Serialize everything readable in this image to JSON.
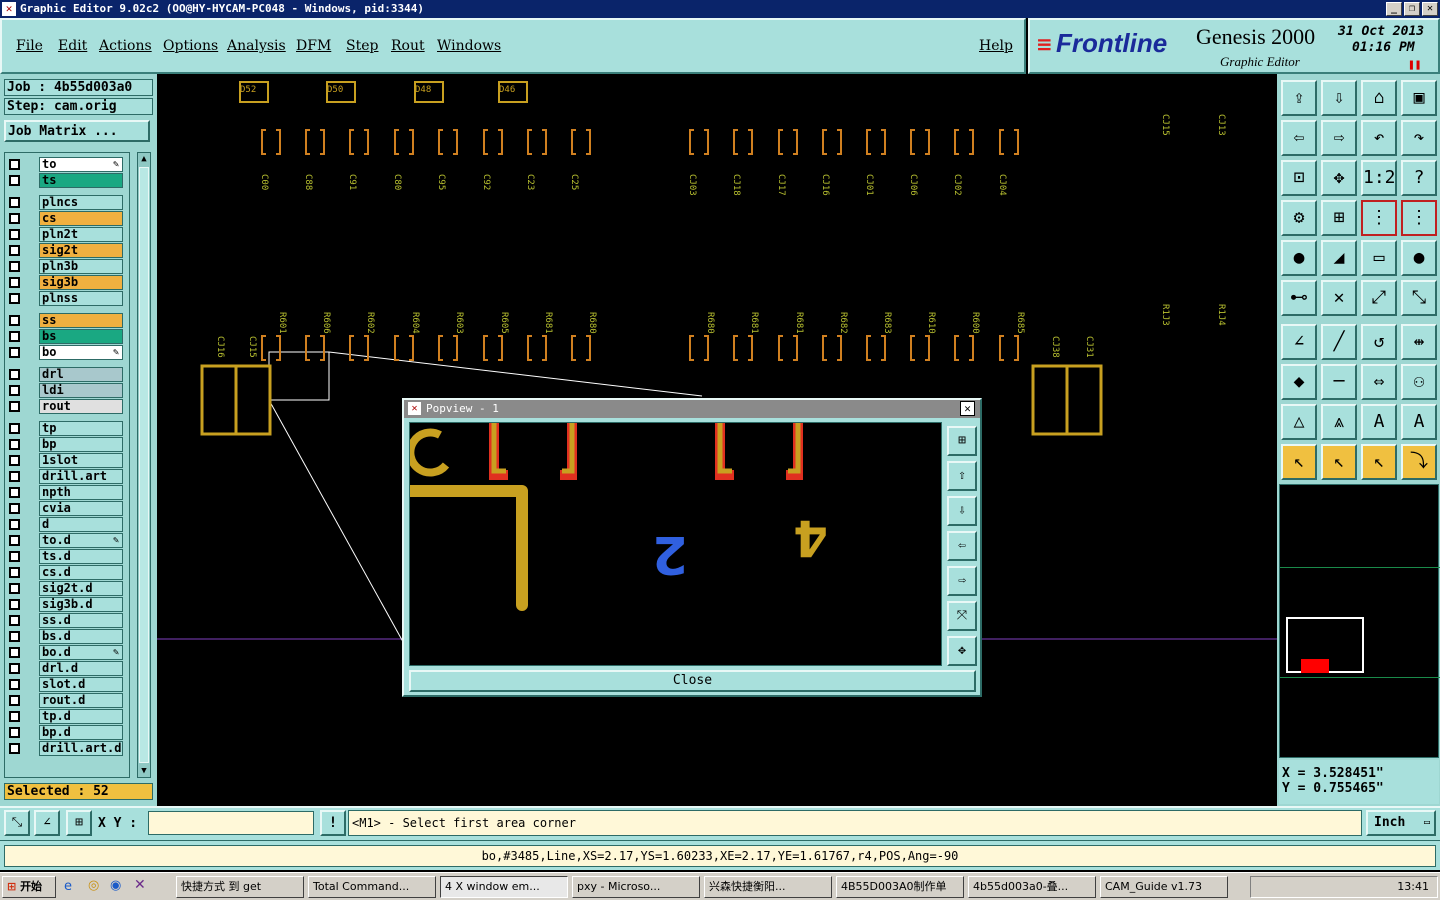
{
  "window": {
    "title": "Graphic Editor 9.02c2 (OO@HY-HYCAM-PC048 - Windows, pid:3344)"
  },
  "menu": [
    "File",
    "Edit",
    "Actions",
    "Options",
    "Analysis",
    "DFM",
    "Step",
    "Rout",
    "Windows"
  ],
  "help_label": "Help",
  "brand": {
    "logo": "Frontline",
    "product": "Genesis 2000",
    "subtitle": "Graphic Editor",
    "date": "31 Oct 2013",
    "time": "01:16 PM"
  },
  "job": {
    "job_label": "Job : 4b55d003a0",
    "step_label": "Step: cam.orig",
    "matrix_button": "Job Matrix ..."
  },
  "layers": [
    {
      "name": "to",
      "color": "#ffffff",
      "edit": true
    },
    {
      "name": "ts",
      "color": "#1aa882",
      "edit": false
    },
    {
      "name": "plncs",
      "color": "#a8e0dc",
      "edit": false
    },
    {
      "name": "cs",
      "color": "#f0b040",
      "edit": false
    },
    {
      "name": "pln2t",
      "color": "#a8e0dc",
      "edit": false
    },
    {
      "name": "sig2t",
      "color": "#f0b040",
      "edit": false
    },
    {
      "name": "pln3b",
      "color": "#a8e0dc",
      "edit": false
    },
    {
      "name": "sig3b",
      "color": "#f0b040",
      "edit": false
    },
    {
      "name": "plnss",
      "color": "#a8e0dc",
      "edit": false
    },
    {
      "name": "ss",
      "color": "#f0b040",
      "edit": false
    },
    {
      "name": "bs",
      "color": "#1aa882",
      "edit": false
    },
    {
      "name": "bo",
      "color": "#ffffff",
      "edit": true
    },
    {
      "name": "drl",
      "color": "#a8c8cc",
      "edit": false
    },
    {
      "name": "ldi",
      "color": "#a8c8cc",
      "edit": false
    },
    {
      "name": "rout",
      "color": "#e0e0e0",
      "edit": false
    },
    {
      "name": "tp",
      "color": "#a8e0dc",
      "edit": false
    },
    {
      "name": "bp",
      "color": "#a8e0dc",
      "edit": false
    },
    {
      "name": "1slot",
      "color": "#a8e0dc",
      "edit": false
    },
    {
      "name": "drill.art",
      "color": "#a8e0dc",
      "edit": false
    },
    {
      "name": "npth",
      "color": "#a8e0dc",
      "edit": false
    },
    {
      "name": "cvia",
      "color": "#a8e0dc",
      "edit": false
    },
    {
      "name": "d",
      "color": "#a8e0dc",
      "edit": false
    },
    {
      "name": "to.d",
      "color": "#a8e0dc",
      "edit": true
    },
    {
      "name": "ts.d",
      "color": "#a8e0dc",
      "edit": false
    },
    {
      "name": "cs.d",
      "color": "#a8e0dc",
      "edit": false
    },
    {
      "name": "sig2t.d",
      "color": "#a8e0dc",
      "edit": false
    },
    {
      "name": "sig3b.d",
      "color": "#a8e0dc",
      "edit": false
    },
    {
      "name": "ss.d",
      "color": "#a8e0dc",
      "edit": false
    },
    {
      "name": "bs.d",
      "color": "#a8e0dc",
      "edit": false
    },
    {
      "name": "bo.d",
      "color": "#a8e0dc",
      "edit": true
    },
    {
      "name": "drl.d",
      "color": "#a8e0dc",
      "edit": false
    },
    {
      "name": "slot.d",
      "color": "#a8e0dc",
      "edit": false
    },
    {
      "name": "rout.d",
      "color": "#a8e0dc",
      "edit": false
    },
    {
      "name": "tp.d",
      "color": "#a8e0dc",
      "edit": false
    },
    {
      "name": "bp.d",
      "color": "#a8e0dc",
      "edit": false
    },
    {
      "name": "drill.art.d",
      "color": "#a8e0dc",
      "edit": false
    }
  ],
  "selected": "Selected : 52",
  "xy_label": "X Y :",
  "xy_value": "",
  "prompt": "<M1> - Select first area corner",
  "units": "Inch",
  "status_line": "bo,#3485,Line,XS=2.17,YS=1.60233,XE=2.17,YE=1.61767,r4,POS,Ang=-90",
  "coords": {
    "x": "X = 3.528451\"",
    "y": "Y = 0.755465\""
  },
  "popview": {
    "title": "Popview - 1",
    "close_label": "Close"
  },
  "canvas_labels": {
    "top_row": [
      "C00",
      "C88",
      "C91",
      "C80",
      "C95",
      "C92",
      "C23",
      "C25",
      "CJ03",
      "CJ18",
      "CJ17",
      "CJ16",
      "CJ01",
      "CJ06",
      "CJ02",
      "CJ04"
    ],
    "mid_row": [
      "R601",
      "R606",
      "R602",
      "R604",
      "R603",
      "R605",
      "R681",
      "R680",
      "R680",
      "R681",
      "R681",
      "R682",
      "R683",
      "R610",
      "R600",
      "R685"
    ],
    "side": [
      "CJ16",
      "CJ15",
      "CJ38",
      "CJ31",
      "CJ15",
      "CJ13",
      "R1J3",
      "R1J4"
    ],
    "top": [
      "D52",
      "D50",
      "D48",
      "D46"
    ]
  },
  "taskbar": {
    "start": "开始",
    "items": [
      "快捷方式 到 get",
      "Total Command...",
      "4 X window em...",
      "pxy - Microso...",
      "兴森快捷衡阳...",
      "4B55D003A0制作单",
      "4b55d003a0-叠...",
      "CAM_Guide v1.73"
    ],
    "clock": "13:41"
  }
}
